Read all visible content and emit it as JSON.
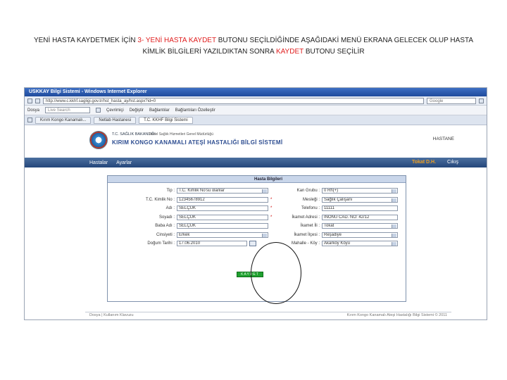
{
  "caption": {
    "line1_a": "YENİ HASTA KAYDETMEK İÇİN ",
    "line1_red": "3- YENİ HASTA KAYDET",
    "line1_b": "  BUTONU SEÇİLDİĞİNDE  AŞAĞIDAKİ  MENÜ EKRANA GELECEK OLUP HASTA",
    "line2_a": "KİMLİK BİLGİLERİ YAZILDIKTAN SONRA ",
    "line2_red": "KAYDET",
    "line2_b": "  BUTONU SEÇİLİR"
  },
  "browser": {
    "title": "USKKAY Bilgi Sistemi - Windows Internet Explorer",
    "address": "http://www.c.kkhf.sagligi.gov.tr/hst_hasta_ay/hst.aspx?id=0",
    "google_placeholder": "Google",
    "menu_label": "Dosya",
    "live_search": "Live Search",
    "toolbar_items": [
      "Çevrimiçi",
      "Değiştir",
      "Bağlantılar",
      "Bağlantıları Özelleştir"
    ],
    "tabs": [
      "Kırım Kongo Kanamalı...",
      "Netlab Hastanesi",
      "T.C. KKHF Bilgi Sistemi"
    ]
  },
  "site": {
    "ministry": "T.C. SAĞLIK BAKANLIĞI",
    "ministry_sub": "Temel Sağlık Hizmetleri Genel Müdürlüğü",
    "system_name": "KIRIM KONGO KANAMALI ATEŞİ HASTALIĞI BİLGİ SİSTEMİ",
    "hospital_label": "HASTANE",
    "nav": [
      "Hastalar",
      "Ayarlar"
    ],
    "user": "Tokat D.H.",
    "logout": "Cıkış"
  },
  "form": {
    "title": "Hasta Bilgileri",
    "left_fields": [
      {
        "label": "Tip :",
        "value": "T.C. Kimlik No'su olanlar",
        "select": true,
        "required": false
      },
      {
        "label": "T.C. Kimlik No :",
        "value": "12345678912",
        "select": false,
        "required": true
      },
      {
        "label": "Adı :",
        "value": "SELÇUK",
        "select": false,
        "required": true
      },
      {
        "label": "Soyadı :",
        "value": "SELÇUK",
        "select": false,
        "required": true
      },
      {
        "label": "Baba Adı :",
        "value": "SELÇUK",
        "select": false,
        "required": false
      },
      {
        "label": "Cinsiyeti :",
        "value": "Erkek",
        "select": true,
        "required": false
      },
      {
        "label": "Doğum Tarihi :",
        "value": "17.06.2010",
        "select": false,
        "required": false
      }
    ],
    "right_fields": [
      {
        "label": "Kan Grubu :",
        "value": "0 Rh(+)",
        "select": true
      },
      {
        "label": "Mesleği :",
        "value": "Sağlık Çalışanı",
        "select": true
      },
      {
        "label": "Telefonu :",
        "value": "11111",
        "select": false
      },
      {
        "label": "İkamet Adresi :",
        "value": "İNÖNÜ CAD. NO: 42/12",
        "select": false
      },
      {
        "label": "İkamet İli :",
        "value": "Tokat",
        "select": true
      },
      {
        "label": "İkamet İlçesi :",
        "value": "Reşadiye",
        "select": true
      },
      {
        "label": "Mahalle - Köy :",
        "value": "Akarköy Köyü",
        "select": true
      }
    ],
    "save_label": "KAYDET"
  },
  "status": {
    "left": "Dosya | Kullanım Klavuzu",
    "right": "Kırım Kongo Kanamalı Ateşi Hastalığı Bilgi Sistemi © 2011"
  }
}
